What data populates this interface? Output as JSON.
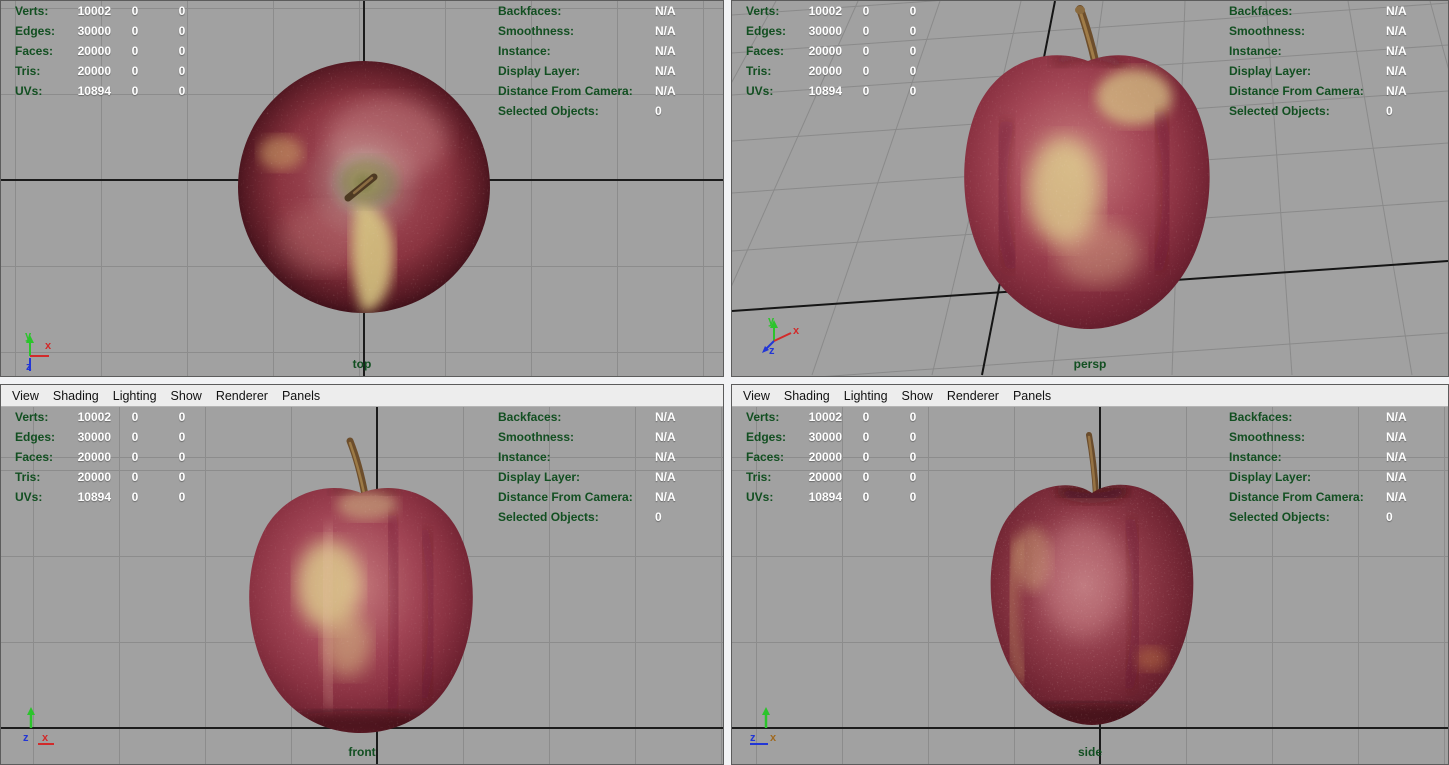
{
  "menu": {
    "items": [
      "View",
      "Shading",
      "Lighting",
      "Show",
      "Renderer",
      "Panels"
    ]
  },
  "hud": {
    "left_rows": [
      {
        "label": "Verts:",
        "value": "10002",
        "extra1": "0",
        "extra2": "0"
      },
      {
        "label": "Edges:",
        "value": "30000",
        "extra1": "0",
        "extra2": "0"
      },
      {
        "label": "Faces:",
        "value": "20000",
        "extra1": "0",
        "extra2": "0"
      },
      {
        "label": "Tris:",
        "value": "20000",
        "extra1": "0",
        "extra2": "0"
      },
      {
        "label": "UVs:",
        "value": "10894",
        "extra1": "0",
        "extra2": "0"
      }
    ],
    "right_rows": [
      {
        "label": "Backfaces:",
        "value": "N/A"
      },
      {
        "label": "Smoothness:",
        "value": "N/A"
      },
      {
        "label": "Instance:",
        "value": "N/A"
      },
      {
        "label": "Display Layer:",
        "value": "N/A"
      },
      {
        "label": "Distance From Camera:",
        "value": "N/A"
      },
      {
        "label": "Selected Objects:",
        "value": "0"
      }
    ]
  },
  "viewports": {
    "top": {
      "label": "top"
    },
    "persp": {
      "label": "persp"
    },
    "front": {
      "label": "front"
    },
    "side": {
      "label": "side"
    }
  },
  "axes": {
    "x": "x",
    "y": "y",
    "z": "z"
  },
  "colors": {
    "viewport_bg": "#a1a1a1",
    "grid_line": "#8c8c8c",
    "axis_line": "#1b1b1b",
    "hud_label_green": "#124f21",
    "hud_value_white": "#ffffff",
    "menu_bg": "#ededed",
    "axis_x_red": "#d22a2a",
    "axis_y_green": "#2bc42b",
    "axis_z_blue": "#2236d6"
  }
}
